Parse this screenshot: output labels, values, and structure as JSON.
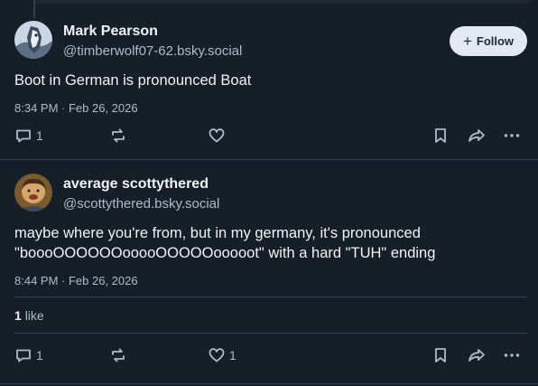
{
  "posts": [
    {
      "author_name": "Mark Pearson",
      "handle": "@timberwolf07-62.bsky.social",
      "text": "Boot in German is pronounced Boat",
      "timestamp": "8:34 PM · Feb 26, 2026",
      "follow_label": "Follow",
      "reply_count": "1",
      "like_count": ""
    },
    {
      "author_name": "average scottythered",
      "handle": "@scottythered.bsky.social",
      "text_line1": "maybe where you're from, but in my germany, it's pronounced",
      "text_line2": "\"boooOOOOOOooooOOOOOooooot\" with a hard \"TUH\" ending",
      "timestamp": "8:44 PM · Feb 26, 2026",
      "likes_summary": {
        "count": "1",
        "label": "like"
      },
      "reply_count": "1",
      "like_count": "1"
    }
  ],
  "colors": {
    "background": "#161e27",
    "divider": "#2e4052",
    "muted_text": "#aebbc9",
    "follow_button_bg": "#e3e9f0"
  },
  "icons": [
    "reply-icon",
    "repost-icon",
    "like-icon",
    "bookmark-icon",
    "share-icon",
    "more-icon",
    "plus-icon"
  ]
}
